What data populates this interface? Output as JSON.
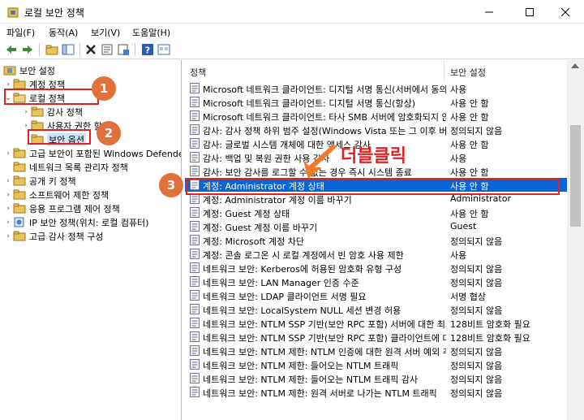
{
  "window": {
    "title": "로컬 보안 정책"
  },
  "menu": [
    "파일(F)",
    "동작(A)",
    "보기(V)",
    "도움말(H)"
  ],
  "tree": {
    "root": "보안 설정",
    "items": [
      {
        "label": "계정 정책",
        "level": 1,
        "expanded": false
      },
      {
        "label": "로컬 정책",
        "level": 1,
        "expanded": true
      },
      {
        "label": "감사 정책",
        "level": 2,
        "expanded": false
      },
      {
        "label": "사용자 권한 할당",
        "level": 2,
        "expanded": false
      },
      {
        "label": "보안 옵션",
        "level": 2,
        "expanded": false,
        "selected": true
      },
      {
        "label": "고급 보안이 포함된 Windows Defender 방화벽",
        "level": 1,
        "expanded": false
      },
      {
        "label": "네트워크 목록 관리자 정책",
        "level": 1,
        "expanded": false
      },
      {
        "label": "공개 키 정책",
        "level": 1,
        "expanded": false
      },
      {
        "label": "소프트웨어 제한 정책",
        "level": 1,
        "expanded": false
      },
      {
        "label": "응용 프로그램 제어 정책",
        "level": 1,
        "expanded": false
      },
      {
        "label": "IP 보안 정책(위치: 로컬 컴퓨터)",
        "level": 1,
        "expanded": false
      },
      {
        "label": "고급 감사 정책 구성",
        "level": 1,
        "expanded": false
      }
    ]
  },
  "list": {
    "columns": [
      "정책",
      "보안 설정"
    ],
    "rows": [
      {
        "policy": "Microsoft 네트워크 클라이언트: 디지털 서명 통신(서버에서 동의한 경우)",
        "setting": "사용"
      },
      {
        "policy": "Microsoft 네트워크 클라이언트: 디지털 서명 통신(항상)",
        "setting": "사용 안 함"
      },
      {
        "policy": "Microsoft 네트워크 클라이언트: 타사 SMB 서버에 암호화되지 않은 암호 보내기",
        "setting": "사용 안 함"
      },
      {
        "policy": "감사: 감사 정책 하위 범주 설정(Windows Vista 또는 그 이후 버전)",
        "setting": "정의되지 않음"
      },
      {
        "policy": "감사: 글로벌 시스템 개체에 대한 액세스 감사",
        "setting": "사용 안 함"
      },
      {
        "policy": "감사: 백업 및 복원 권한 사용 감사",
        "setting": "사용"
      },
      {
        "policy": "감사: 보안 감사를 로그할 수 없는 경우 즉시 시스템 종료",
        "setting": "사용 안 함"
      },
      {
        "policy": "계정: Administrator 계정 상태",
        "setting": "사용 안 함",
        "selected": true
      },
      {
        "policy": "계정: Administrator 계정 이름 바꾸기",
        "setting": "Administrator"
      },
      {
        "policy": "계정: Guest 계정 상태",
        "setting": "사용 안 함"
      },
      {
        "policy": "계정: Guest 계정 이름 바꾸기",
        "setting": "Guest"
      },
      {
        "policy": "계정: Microsoft 계정 차단",
        "setting": "정의되지 않음"
      },
      {
        "policy": "계정: 콘솔 로그온 시 로컬 계정에서 빈 암호 사용 제한",
        "setting": "사용"
      },
      {
        "policy": "네트워크 보안: Kerberos에 허용된 암호화 유형 구성",
        "setting": "정의되지 않음"
      },
      {
        "policy": "네트워크 보안: LAN Manager 인증 수준",
        "setting": "정의되지 않음"
      },
      {
        "policy": "네트워크 보안: LDAP 클라이언트 서명 필요",
        "setting": "서명 협상"
      },
      {
        "policy": "네트워크 보안: LocalSystem NULL 세션 변경 허용",
        "setting": "정의되지 않음"
      },
      {
        "policy": "네트워크 보안: NTLM SSP 기반(보안 RPC 포함) 서버에 대한 최소 세션 보안",
        "setting": "128비트 암호화 필요"
      },
      {
        "policy": "네트워크 보안: NTLM SSP 기반(보안 RPC 포함) 클라이언트에 대한 최소 세션 보안",
        "setting": "128비트 암호화 필요"
      },
      {
        "policy": "네트워크 보안: NTLM 제한: NTLM 인증에 대한 원격 서버 예외 추가",
        "setting": "정의되지 않음"
      },
      {
        "policy": "네트워크 보안: NTLM 제한: 들어오는 NTLM 트래픽",
        "setting": "정의되지 않음"
      },
      {
        "policy": "네트워크 보안: NTLM 제한: 들어오는 NTLM 트래픽 감사",
        "setting": "정의되지 않음"
      },
      {
        "policy": "네트워크 보안: NTLM 제한: 원격 서버로 나가는 NTLM 트래픽",
        "setting": "정의되지 않음"
      }
    ]
  },
  "annotations": {
    "step1": "1",
    "step2": "2",
    "step3": "3",
    "double_click": "더블클릭"
  },
  "colors": {
    "selection": "#0a64d6",
    "annotation_red": "#e02222",
    "callout_orange": "#e2703a",
    "folder_yellow": "#e8c35a"
  }
}
